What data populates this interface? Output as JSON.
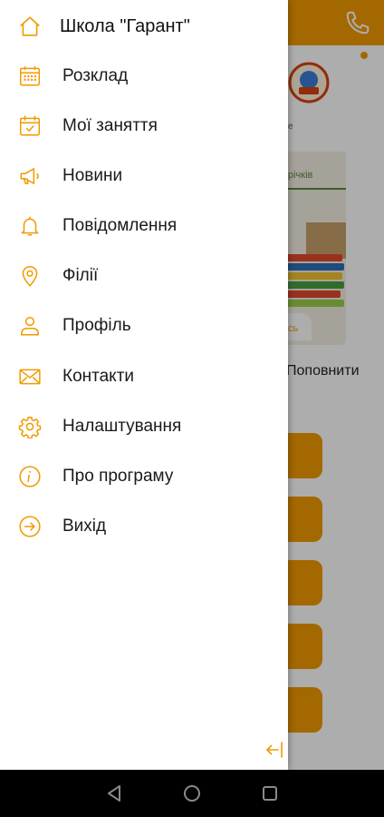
{
  "theme": {
    "accent": "#f29a00",
    "drawer_bg": "#ffffff",
    "text": "#1a1a1a",
    "nav_bar_bg": "#000000"
  },
  "drawer": {
    "header": {
      "icon": "home-icon",
      "title": "Школа \"Гарант\""
    },
    "items": [
      {
        "icon": "calendar-grid-icon",
        "label": "Розклад"
      },
      {
        "icon": "calendar-check-icon",
        "label": "Мої заняття"
      },
      {
        "icon": "megaphone-icon",
        "label": "Новини"
      },
      {
        "icon": "bell-icon",
        "label": "Повідомлення"
      },
      {
        "icon": "map-pin-icon",
        "label": "Філії"
      },
      {
        "icon": "user-icon",
        "label": "Профіль"
      },
      {
        "icon": "envelope-icon",
        "label": "Контакти"
      },
      {
        "icon": "gear-icon",
        "label": "Налаштування"
      },
      {
        "icon": "info-icon",
        "label": "Про програму"
      },
      {
        "icon": "exit-icon",
        "label": "Вихід"
      }
    ],
    "collapse_icon": "collapse-arrow-icon"
  },
  "background": {
    "header_icon": "phone-icon",
    "banner_text": "річків",
    "banner_small": "сь",
    "topup_label": "Поповнити"
  },
  "nav_bar": {
    "buttons": [
      "back-icon",
      "home-circle-icon",
      "recents-icon"
    ]
  }
}
